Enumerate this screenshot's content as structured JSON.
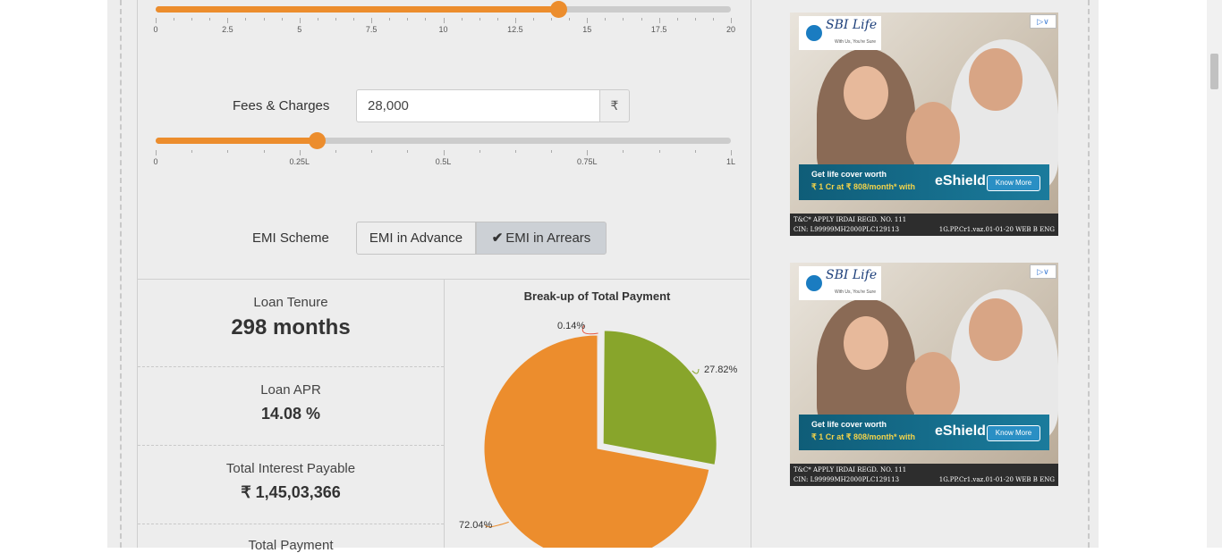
{
  "tenure_slider": {
    "fill_fraction": 0.7,
    "tick_labels": [
      "0",
      "2.5",
      "5",
      "7.5",
      "10",
      "12.5",
      "15",
      "17.5",
      "20"
    ]
  },
  "fees": {
    "label": "Fees & Charges",
    "value": "28,000",
    "currency": "₹",
    "fill_fraction": 0.28,
    "tick_labels": [
      "0",
      "0.25L",
      "0.5L",
      "0.75L",
      "1L"
    ]
  },
  "emi_scheme": {
    "label": "EMI Scheme",
    "options": [
      "EMI in Advance",
      "EMI in Arrears"
    ],
    "selected": "EMI in Arrears",
    "check_icon": "check-icon"
  },
  "results": {
    "tenure": {
      "title": "Loan Tenure",
      "value": "298 months"
    },
    "apr": {
      "title": "Loan APR",
      "value": "14.08 %"
    },
    "interest": {
      "title": "Total Interest Payable",
      "value": "₹ 1,45,03,366"
    },
    "payment": {
      "title": "Total Payment"
    }
  },
  "chart_data": {
    "type": "pie",
    "title": "Break-up of Total Payment",
    "slices": [
      {
        "label": "0.14%",
        "value": 0.14,
        "color": "#e8563f"
      },
      {
        "label": "27.82%",
        "value": 27.82,
        "color": "#88a52b"
      },
      {
        "label": "72.04%",
        "value": 72.04,
        "color": "#ec8d2d"
      }
    ]
  },
  "ads": [
    {
      "brand": "SBI Life",
      "brand_sub": "INSURANCE",
      "tagline": "With Us, You're Sure",
      "headline": "Get life cover worth",
      "offer": "₹ 1 Cr at ₹ 808/month* with",
      "product": "eShield",
      "cta": "Know More",
      "footer1": "T&C* APPLY IRDAI REGD. NO. 111",
      "footer2": "CIN: L99999MH2000PLC129113",
      "footer3": "1G.PP.Cr1.vaz.01-01-20 WEB B ENG"
    },
    {
      "brand": "SBI Life",
      "brand_sub": "INSURANCE",
      "tagline": "With Us, You're Sure",
      "headline": "Get life cover worth",
      "offer": "₹ 1 Cr at ₹ 808/month* with",
      "product": "eShield",
      "cta": "Know More",
      "footer1": "T&C* APPLY IRDAI REGD. NO. 111",
      "footer2": "CIN: L99999MH2000PLC129113",
      "footer3": "1G.PP.Cr1.vaz.01-01-20 WEB B ENG"
    }
  ]
}
